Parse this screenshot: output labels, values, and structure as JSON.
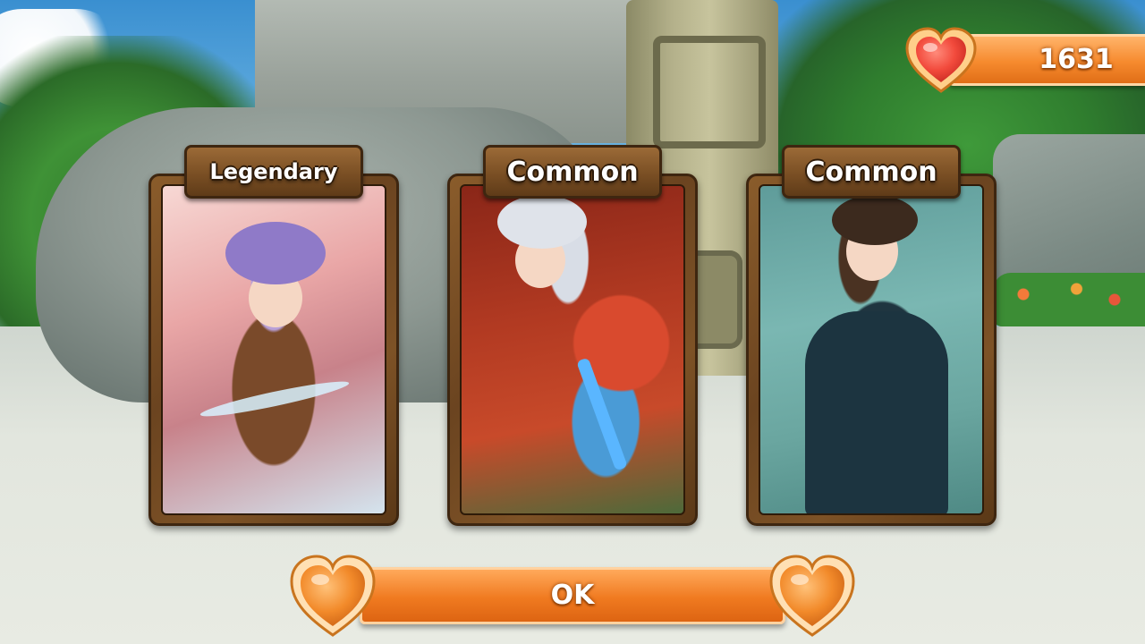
{
  "currency": {
    "icon": "heart-icon",
    "value": "1631"
  },
  "cards": [
    {
      "rarity": "Legendary",
      "art": "purple-haired-winged-girl-portrait"
    },
    {
      "rarity": "Common",
      "art": "white-haired-swordswoman-portrait"
    },
    {
      "rarity": "Common",
      "art": "dark-haired-ninja-woman-portrait"
    }
  ],
  "ok_button": {
    "label": "OK",
    "icons": [
      "heart-icon",
      "heart-icon"
    ]
  },
  "colors": {
    "accent": "#f07a20",
    "heart": "#f24a3c",
    "wood": "#7a4f24"
  }
}
